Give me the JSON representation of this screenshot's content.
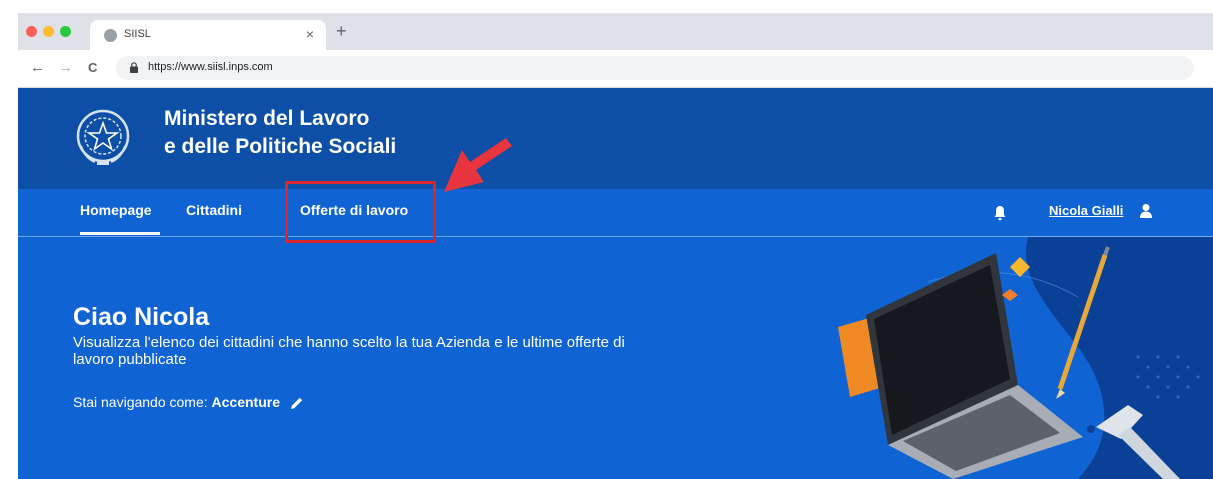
{
  "browser": {
    "tab_title": "SIISL",
    "tab_close": "×",
    "new_tab": "+",
    "url": "https://www.siisl.inps.com",
    "back": "←",
    "forward": "→",
    "reload": "C"
  },
  "header": {
    "ministry_line1": "Ministero del Lavoro",
    "ministry_line2": "e delle Politiche Sociali"
  },
  "nav": {
    "items": [
      {
        "label": "Homepage",
        "active": true
      },
      {
        "label": "Cittadini",
        "active": false
      },
      {
        "label": "Offerte di lavoro",
        "active": false,
        "highlighted": true
      }
    ],
    "user_name": "Nicola Gialli"
  },
  "hero": {
    "title": "Ciao Nicola",
    "description": "Visualizza l'elenco dei cittadini che hanno scelto la tua Azienda e le ultime offerte di lavoro pubblicate",
    "navigating_as_label": "Stai navigando come:",
    "company": "Accenture"
  },
  "colors": {
    "header_blue": "#0d4ea6",
    "nav_blue": "#0f63d3",
    "highlight_red": "#d8262d"
  },
  "icons": [
    "bell-icon",
    "user-icon",
    "pencil-icon",
    "lock-icon",
    "emblem-logo",
    "arrow-annotation"
  ]
}
